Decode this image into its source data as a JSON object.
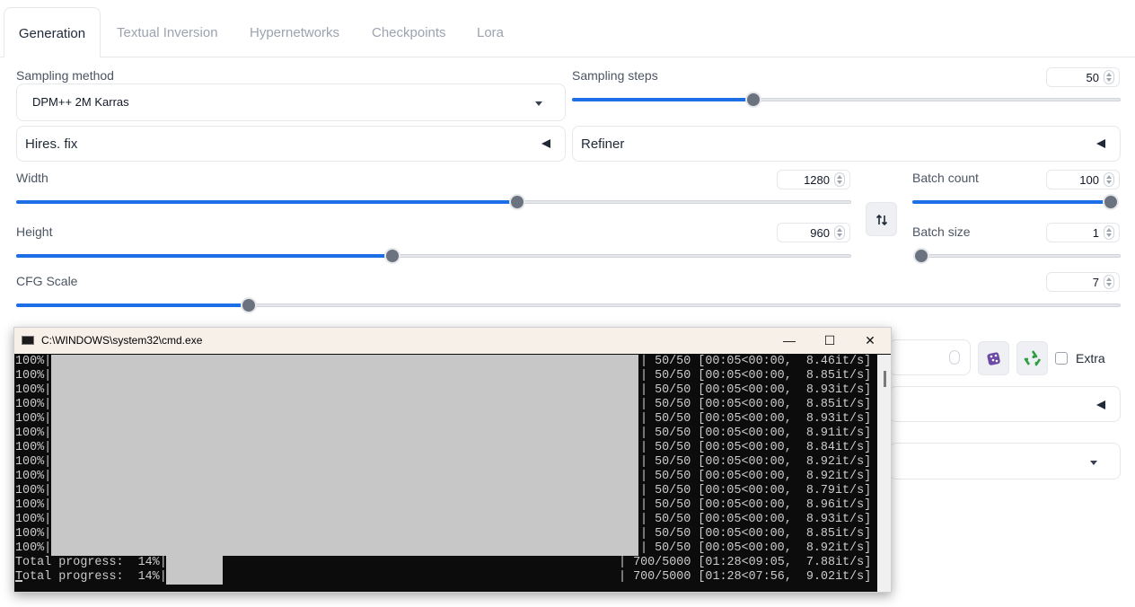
{
  "tabs": [
    "Generation",
    "Textual Inversion",
    "Hypernetworks",
    "Checkpoints",
    "Lora"
  ],
  "sampling_method": {
    "label": "Sampling method",
    "value": "DPM++ 2M Karras"
  },
  "sampling_steps": {
    "label": "Sampling steps",
    "value": "50",
    "fraction": 0.33
  },
  "hires_fix": {
    "label": "Hires. fix"
  },
  "refiner": {
    "label": "Refiner"
  },
  "width": {
    "label": "Width",
    "value": "1280",
    "fraction": 0.6
  },
  "height": {
    "label": "Height",
    "value": "960",
    "fraction": 0.45
  },
  "batch_count": {
    "label": "Batch count",
    "value": "100",
    "fraction": 1.0
  },
  "batch_size": {
    "label": "Batch size",
    "value": "1",
    "fraction": 0.0
  },
  "cfg_scale": {
    "label": "CFG Scale",
    "value": "7",
    "fraction": 0.21
  },
  "extra": {
    "label": "Extra"
  },
  "icons": [
    "swap-icon",
    "dice-icon",
    "recycle-icon",
    "cmd-icon"
  ],
  "cmd": {
    "title": "C:\\WINDOWS\\system32\\cmd.exe",
    "minimize": "—",
    "maximize": "☐",
    "close": "✕",
    "rows": [
      {
        "pct": "100%|",
        "stats": "| 50/50 [00:05<00:00,  8.46it/s]"
      },
      {
        "pct": "100%|",
        "stats": "| 50/50 [00:05<00:00,  8.85it/s]"
      },
      {
        "pct": "100%|",
        "stats": "| 50/50 [00:05<00:00,  8.93it/s]"
      },
      {
        "pct": "100%|",
        "stats": "| 50/50 [00:05<00:00,  8.85it/s]"
      },
      {
        "pct": "100%|",
        "stats": "| 50/50 [00:05<00:00,  8.93it/s]"
      },
      {
        "pct": "100%|",
        "stats": "| 50/50 [00:05<00:00,  8.91it/s]"
      },
      {
        "pct": "100%|",
        "stats": "| 50/50 [00:05<00:00,  8.84it/s]"
      },
      {
        "pct": "100%|",
        "stats": "| 50/50 [00:05<00:00,  8.92it/s]"
      },
      {
        "pct": "100%|",
        "stats": "| 50/50 [00:05<00:00,  8.92it/s]"
      },
      {
        "pct": "100%|",
        "stats": "| 50/50 [00:05<00:00,  8.79it/s]"
      },
      {
        "pct": "100%|",
        "stats": "| 50/50 [00:05<00:00,  8.96it/s]"
      },
      {
        "pct": "100%|",
        "stats": "| 50/50 [00:05<00:00,  8.93it/s]"
      },
      {
        "pct": "100%|",
        "stats": "| 50/50 [00:05<00:00,  8.85it/s]"
      },
      {
        "pct": "100%|",
        "stats": "| 50/50 [00:05<00:00,  8.92it/s]"
      }
    ],
    "totals": [
      {
        "label": "Total progress:  14%|",
        "stats": "| 700/5000 [01:28<09:05,  7.88it/s]"
      },
      {
        "label": "Total progress:  14%|",
        "stats": "| 700/5000 [01:28<07:56,  9.02it/s]"
      }
    ]
  },
  "colors": {
    "accent": "#1d6fe8",
    "thumb": "#6b7280",
    "console_bg": "#0c0c0c",
    "console_fg": "#cccccc"
  }
}
